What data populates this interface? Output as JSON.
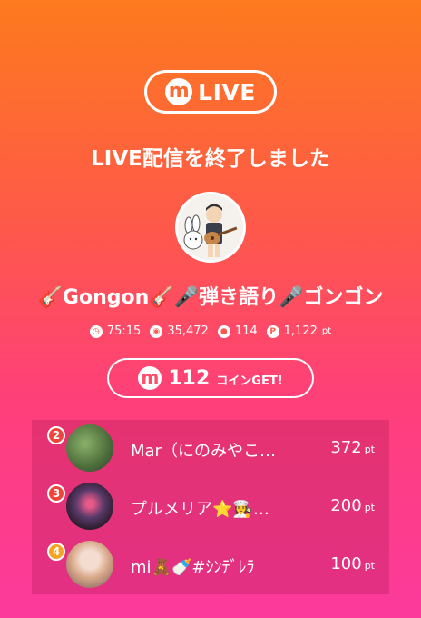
{
  "header": {
    "logo_letter": "m",
    "live_label": "LIVE"
  },
  "status_text": "LIVE配信を終了しました",
  "stream_title": "🎸Gongon🎸🎤弾き語り🎤ゴンゴン",
  "stats": {
    "duration": "75:15",
    "viewers": "35,472",
    "comments": "114",
    "points": "1,122",
    "points_unit": "pt"
  },
  "coins": {
    "logo_letter": "m",
    "amount": "112",
    "label": "コインGET!"
  },
  "ranking": [
    {
      "rank": "2",
      "name": "Mar（にのみやこ…",
      "points": "372",
      "unit": "pt",
      "badge_color": "#f0443a"
    },
    {
      "rank": "3",
      "name": "プルメリア⭐👩‍🍳…",
      "points": "200",
      "unit": "pt",
      "badge_color": "#f0443a"
    },
    {
      "rank": "4",
      "name": "mi🧸🍼#ｼﾝﾃﾞﾚﾗ",
      "points": "100",
      "unit": "pt",
      "badge_color": "#f5a323"
    }
  ],
  "icons": [
    "timer-icon",
    "viewers-icon",
    "comment-icon",
    "points-icon"
  ]
}
